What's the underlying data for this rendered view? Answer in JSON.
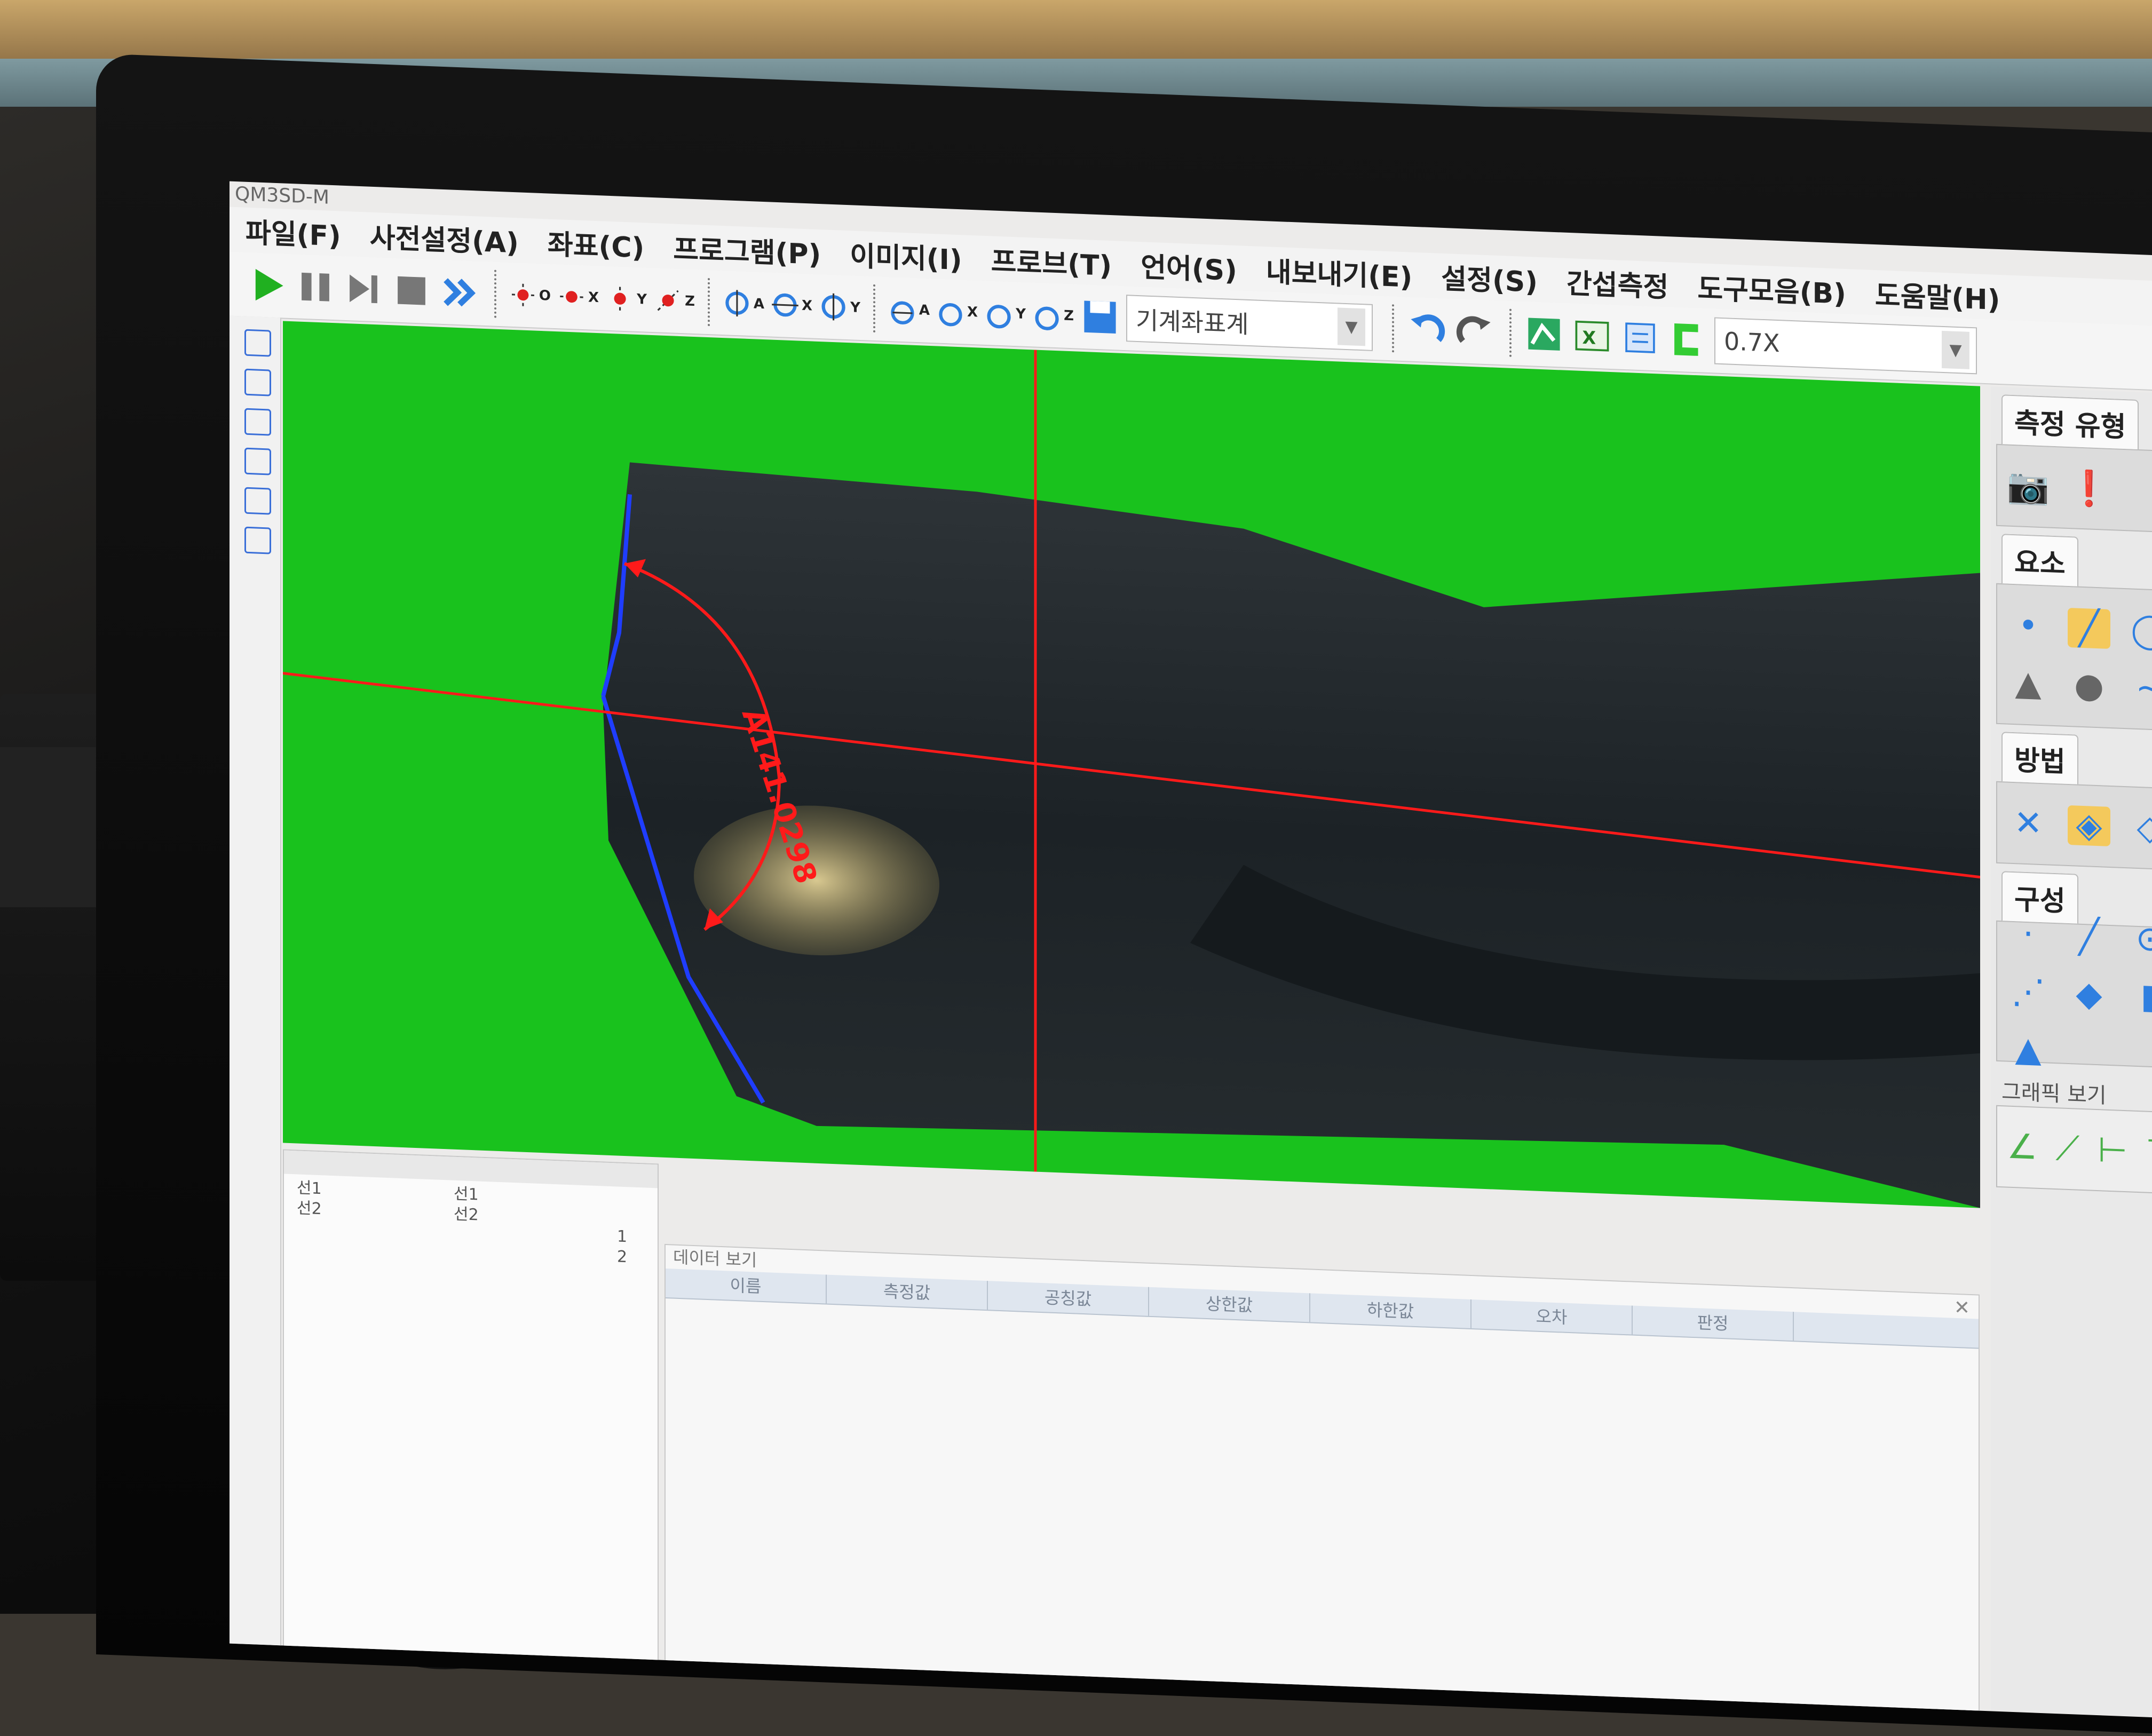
{
  "window": {
    "title": "QM3SD-M"
  },
  "menu": [
    {
      "label": "파일(F)"
    },
    {
      "label": "사전설정(A)"
    },
    {
      "label": "좌표(C)"
    },
    {
      "label": "프로그램(P)"
    },
    {
      "label": "이미지(I)"
    },
    {
      "label": "프로브(T)"
    },
    {
      "label": "언어(S)"
    },
    {
      "label": "내보내기(E)"
    },
    {
      "label": "설정(S)"
    },
    {
      "label": "간섭측정"
    },
    {
      "label": "도구모음(B)"
    },
    {
      "label": "도움말(H)"
    }
  ],
  "toolbar": {
    "axis_labels": {
      "origin": "O",
      "x": "X",
      "y": "Y",
      "z": "Z",
      "a": "A"
    },
    "coordinate_system": "기계좌표계",
    "zoom": "0.7X"
  },
  "colors": {
    "camera_background": "#19c21d",
    "crosshair": "#ff1a1a",
    "edge_highlight": "#1f3dff",
    "accent_blue": "#2f7fe0",
    "selected_tool": "#f4c95c"
  },
  "measurement": {
    "label": "A141.0298"
  },
  "right_panel": {
    "measure_type_tab": "측정 유형",
    "element_tab": "요소",
    "method_tab": "방법",
    "construct_tab": "구성",
    "graphic_view_title": "그래픽 보기"
  },
  "left_list": {
    "rows": [
      {
        "col1": "선1",
        "col2": "선1"
      },
      {
        "col1": "선2",
        "col2": "선2"
      }
    ],
    "row_numbers": [
      "1",
      "2"
    ]
  },
  "data_view": {
    "title": "데이터 보기",
    "columns": [
      "이름",
      "측정값",
      "공칭값",
      "상한값",
      "하한값",
      "오차",
      "판정"
    ],
    "close": "✕"
  },
  "icons": [
    "play-icon",
    "pause-icon",
    "step-icon",
    "stop-icon",
    "fast-forward-icon",
    "save-icon",
    "undo-icon",
    "redo-icon",
    "excel-icon",
    "report-icon",
    "camera-icon",
    "probe-icon"
  ]
}
